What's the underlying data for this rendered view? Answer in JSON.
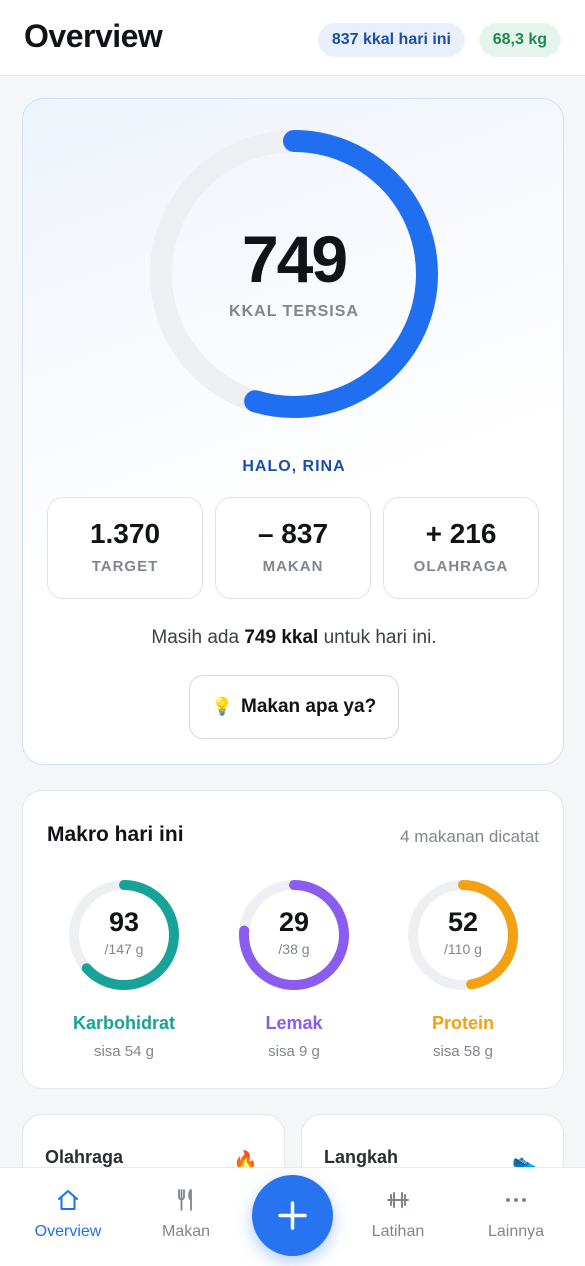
{
  "header": {
    "title": "Overview",
    "kcal_chip": "837 kkal hari ini",
    "weight_chip": "68,3 kg"
  },
  "calorie_ring": {
    "value": "749",
    "label": "KKAL TERSISA",
    "progress_fraction": 0.547,
    "color": "#1f6ff0",
    "track_color": "#eeeff2"
  },
  "greeting": "HALO, RINA",
  "stats": [
    {
      "value": "1.370",
      "label": "TARGET"
    },
    {
      "value": "– 837",
      "label": "MAKAN"
    },
    {
      "value": "+ 216",
      "label": "OLAHRAGA"
    }
  ],
  "summary": {
    "prefix": "Masih ada ",
    "highlight": "749 kkal",
    "suffix": " untuk hari ini."
  },
  "suggest_button": {
    "icon": "lightbulb-icon",
    "label": "Makan apa ya?"
  },
  "macros": {
    "title": "Makro hari ini",
    "logged": "4 makanan dicatat",
    "items": [
      {
        "value": "93",
        "goal": "/147 g",
        "name": "Karbohidrat",
        "remaining": "sisa 54 g",
        "fraction": 0.633,
        "color": "#17a398"
      },
      {
        "value": "29",
        "goal": "/38 g",
        "name": "Lemak",
        "remaining": "sisa 9 g",
        "fraction": 0.763,
        "color": "#8a5cf0"
      },
      {
        "value": "52",
        "goal": "/110 g",
        "name": "Protein",
        "remaining": "sisa 58 g",
        "fraction": 0.473,
        "color": "#f3a012"
      }
    ]
  },
  "cards": [
    {
      "title": "Olahraga",
      "icon": "flame-icon"
    },
    {
      "title": "Langkah",
      "icon": "shoe-icon"
    }
  ],
  "nav": {
    "items": [
      {
        "label": "Overview",
        "icon": "home-icon"
      },
      {
        "label": "Makan",
        "icon": "utensils-icon"
      },
      {
        "label": "Latihan",
        "icon": "dumbbell-icon"
      },
      {
        "label": "Lainnya",
        "icon": "more-icon"
      }
    ],
    "fab_icon": "plus-icon",
    "active_color": "#1f6ff0"
  }
}
